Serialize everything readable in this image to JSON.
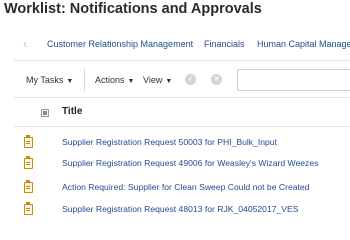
{
  "page": {
    "title": "Worklist: Notifications and Approvals"
  },
  "nav": {
    "prev_icon": "chevron-left-icon",
    "tabs": [
      {
        "label": "Customer Relationship Management"
      },
      {
        "label": "Financials"
      },
      {
        "label": "Human Capital Manage"
      }
    ]
  },
  "toolbar": {
    "my_tasks": "My Tasks",
    "actions": "Actions",
    "view": "View",
    "approve_icon": "check-circle-icon",
    "reject_icon": "x-circle-icon",
    "filter_value": ""
  },
  "table": {
    "columns": [
      {
        "label": "Title"
      }
    ],
    "rows": [
      {
        "icon": "notification-clipboard-icon",
        "title": "Supplier Registration Request 50003 for PHI_Bulk_Input"
      },
      {
        "icon": "notification-clipboard-icon",
        "title": "Supplier Registration Request 49006 for Weasley's Wizard Weezes"
      },
      {
        "icon": "notification-clipboard-icon",
        "title": "Action Required: Supplier for Clean Sweep Could not be Created"
      },
      {
        "icon": "notification-clipboard-icon",
        "title": "Supplier Registration Request 48013 for RJK_04052017_VES"
      }
    ]
  },
  "colors": {
    "link": "#1f4c8f",
    "icon_accent": "#c48a15",
    "disabled_icon": "#d4d4d4"
  }
}
